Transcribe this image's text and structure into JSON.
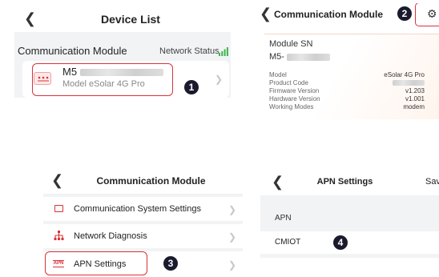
{
  "device_list": {
    "title": "Device List",
    "section_label": "Communication Module",
    "network_status_label": "Network Status",
    "device": {
      "sn_prefix": "M5",
      "model_label": "Model",
      "model_value": "eSolar 4G Pro"
    },
    "step": "1"
  },
  "module_details": {
    "title": "Communication Module",
    "step": "2",
    "sn_label": "Module SN",
    "sn_prefix": "M5-",
    "fields": [
      {
        "label": "Model",
        "value": "eSolar 4G Pro"
      },
      {
        "label": "Product Code",
        "value": ""
      },
      {
        "label": "Firmware Version",
        "value": "v1.203"
      },
      {
        "label": "Hardware Version",
        "value": "v1.001"
      },
      {
        "label": "Working Modes",
        "value": "modem"
      }
    ]
  },
  "module_menu": {
    "title": "Communication Module",
    "items": [
      {
        "label": "Communication System Settings"
      },
      {
        "label": "Network Diagnosis"
      },
      {
        "label": "APN Settings"
      }
    ],
    "step": "3"
  },
  "apn_settings": {
    "title": "APN Settings",
    "save_label": "Sav",
    "field_label": "APN",
    "field_value": "CMIOT",
    "step": "4"
  },
  "colors": {
    "accent_red": "#d9323a",
    "signal_green": "#3bb54a",
    "badge": "#1a1a2e"
  }
}
